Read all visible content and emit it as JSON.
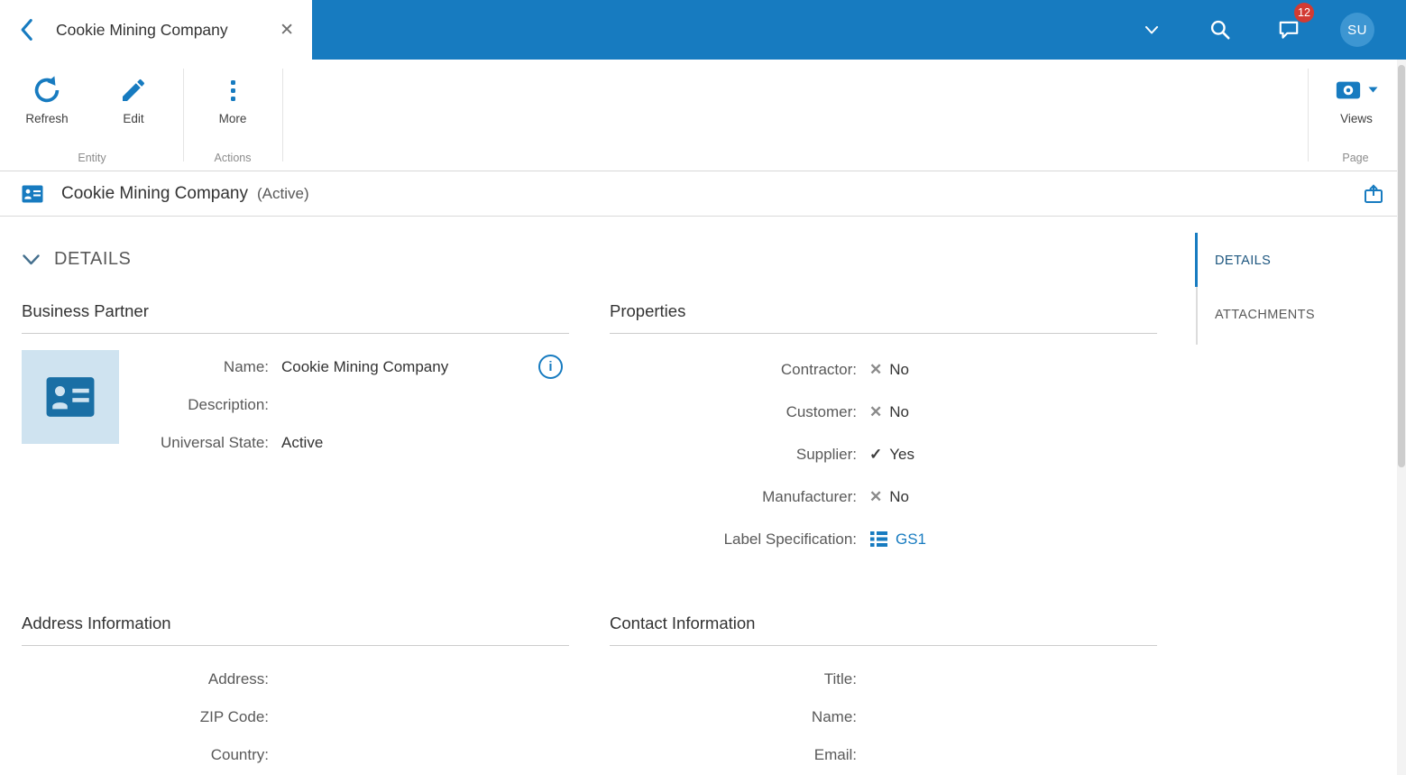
{
  "colors": {
    "primary": "#177bc0",
    "avatar_bg": "#3d96d2",
    "badge_red": "#d23b33",
    "bp_box_bg": "#cfe3f0"
  },
  "topbar": {
    "tab_title": "Cookie Mining Company",
    "close_glyph": "✕",
    "notification_count": "12",
    "avatar_initials": "SU"
  },
  "ribbon": {
    "refresh_label": "Refresh",
    "edit_label": "Edit",
    "more_label": "More",
    "views_label": "Views",
    "group_entity": "Entity",
    "group_actions": "Actions",
    "group_page": "Page"
  },
  "titlebar": {
    "title": "Cookie Mining Company",
    "status": "(Active)"
  },
  "main": {
    "section_title": "DETAILS",
    "business_partner": {
      "heading": "Business Partner",
      "fields": [
        {
          "label": "Name:",
          "value": "Cookie Mining Company"
        },
        {
          "label": "Description:",
          "value": ""
        },
        {
          "label": "Universal State:",
          "value": "Active"
        }
      ],
      "info_glyph": "i"
    },
    "properties": {
      "heading": "Properties",
      "fields": [
        {
          "label": "Contractor:",
          "value": "No",
          "icon": "x"
        },
        {
          "label": "Customer:",
          "value": "No",
          "icon": "x"
        },
        {
          "label": "Supplier:",
          "value": "Yes",
          "icon": "check"
        },
        {
          "label": "Manufacturer:",
          "value": "No",
          "icon": "x"
        },
        {
          "label": "Label Specification:",
          "value": "GS1",
          "icon": "list"
        }
      ],
      "x_glyph": "✕",
      "check_glyph": "✓"
    },
    "address_information": {
      "heading": "Address Information",
      "fields": [
        {
          "label": "Address:",
          "value": ""
        },
        {
          "label": "ZIP Code:",
          "value": ""
        },
        {
          "label": "Country:",
          "value": ""
        }
      ]
    },
    "contact_information": {
      "heading": "Contact Information",
      "fields": [
        {
          "label": "Title:",
          "value": ""
        },
        {
          "label": "Name:",
          "value": ""
        },
        {
          "label": "Email:",
          "value": ""
        }
      ]
    }
  },
  "sidenav": {
    "items": [
      {
        "label": "DETAILS",
        "active": true
      },
      {
        "label": "ATTACHMENTS",
        "active": false
      }
    ]
  }
}
